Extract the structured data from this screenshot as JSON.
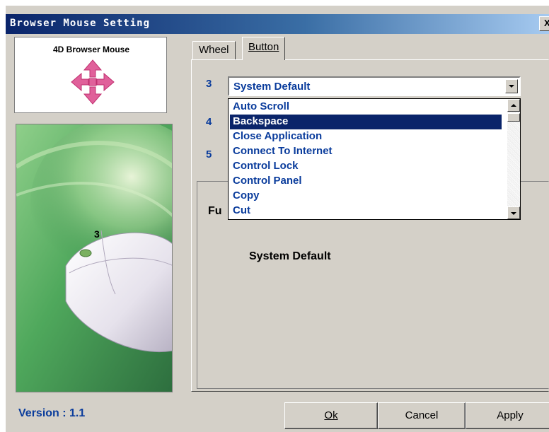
{
  "window": {
    "title": "Browser Mouse Setting",
    "close_label": "X"
  },
  "logo": {
    "text": "4D Browser Mouse",
    "icon": "four-way-arrow-icon"
  },
  "image": {
    "label": "3"
  },
  "version_text": "Version : 1.1",
  "tabs": [
    {
      "label": "Wheel",
      "selected": false
    },
    {
      "label": "Button",
      "selected": true
    }
  ],
  "buttons": {
    "num3": "3",
    "num4": "4",
    "num5": "5"
  },
  "combo": {
    "value": "System Default"
  },
  "dropdown": {
    "items": [
      "Auto Scroll",
      "Backspace",
      "Close Application",
      "Connect To Internet",
      "Control Lock",
      "Control Panel",
      "Copy",
      "Cut"
    ],
    "selected_index": 1
  },
  "function": {
    "label_partial": "Fu",
    "value": "System Default"
  },
  "footer": {
    "ok": "Ok",
    "cancel": "Cancel",
    "apply": "Apply"
  },
  "colors": {
    "accent_text": "#0a3c9c",
    "selection": "#0a246a",
    "titlebar_start": "#0a246a",
    "face": "#d4d0c8"
  }
}
